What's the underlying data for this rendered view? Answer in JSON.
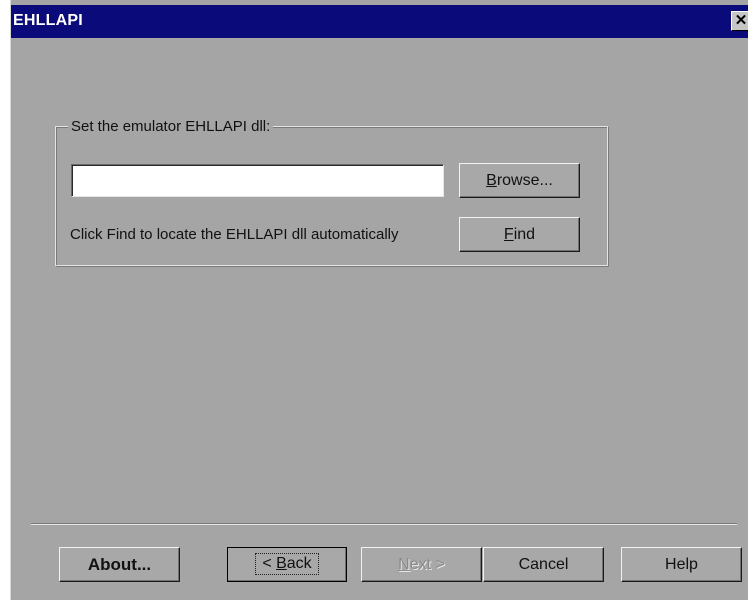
{
  "window": {
    "title": "EHLLAPI",
    "close_glyph": "✕"
  },
  "group": {
    "legend": "Set the emulator EHLLAPI dll:",
    "dll_path_value": "",
    "browse_label": {
      "mnemonic": "B",
      "rest": "rowse..."
    },
    "find_hint": "Click Find to locate the EHLLAPI dll automatically",
    "find_label": {
      "mnemonic": "F",
      "rest": "ind"
    }
  },
  "footer": {
    "about_label": "About...",
    "back_label": {
      "prefix": "< ",
      "mnemonic": "B",
      "rest": "ack"
    },
    "next_label": {
      "mnemonic": "N",
      "rest": "ext >"
    },
    "cancel_label": "Cancel",
    "help_label": "Help"
  },
  "colors": {
    "titlebar": "#0a0a7a",
    "face": "#a5a5a5",
    "disabled_text": "#8a8a8a"
  }
}
